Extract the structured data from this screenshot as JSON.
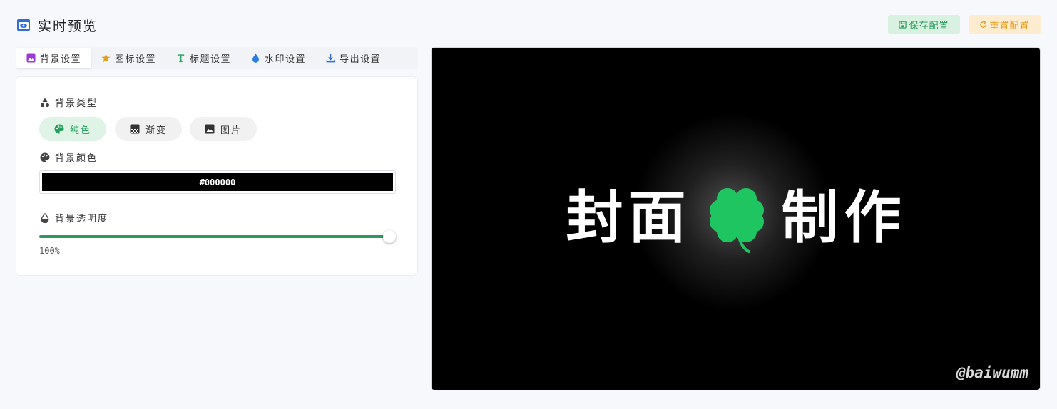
{
  "header": {
    "title": "实时预览",
    "save_label": "保存配置",
    "reset_label": "重置配置"
  },
  "tabs": [
    {
      "label": "背景设置",
      "icon": "image-icon",
      "active": true
    },
    {
      "label": "图标设置",
      "icon": "star-icon",
      "active": false
    },
    {
      "label": "标题设置",
      "icon": "text-t-icon",
      "active": false
    },
    {
      "label": "水印设置",
      "icon": "droplet-icon",
      "active": false
    },
    {
      "label": "导出设置",
      "icon": "download-icon",
      "active": false
    }
  ],
  "panel": {
    "bg_type_label": "背景类型",
    "bg_types": [
      {
        "label": "纯色",
        "icon": "palette-icon",
        "active": true
      },
      {
        "label": "渐变",
        "icon": "gradient-icon",
        "active": false
      },
      {
        "label": "图片",
        "icon": "image-icon",
        "active": false
      }
    ],
    "bg_color_label": "背景颜色",
    "bg_color_value": "#000000",
    "opacity_label": "背景透明度",
    "opacity_value": "100%",
    "opacity_level": 1.0
  },
  "preview": {
    "title_left": "封面",
    "title_right": "制作",
    "icon": "four-leaf-clover-icon",
    "watermark": "@baiwumm",
    "background": "#000000",
    "clover_color": "#1fc560"
  },
  "colors": {
    "accent_green": "#2c9a5f",
    "save_bg": "#d8f1e1",
    "reset_bg": "#fdeccf"
  }
}
